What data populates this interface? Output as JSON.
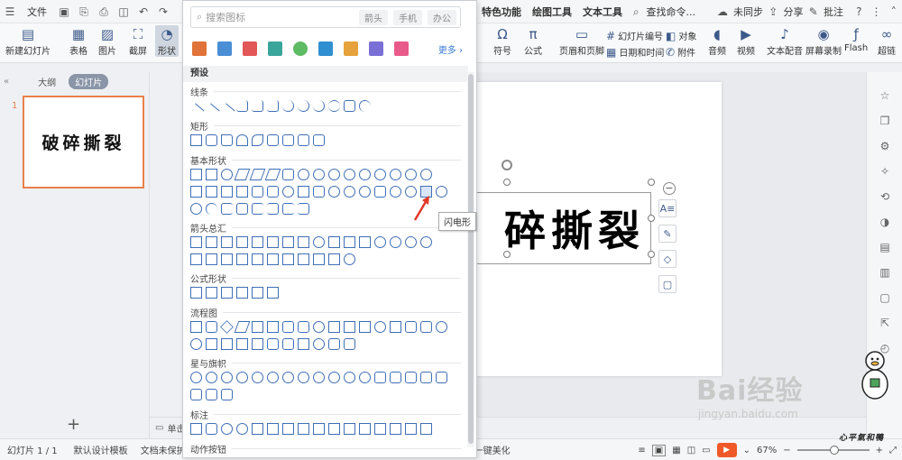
{
  "menubar": {
    "file_label": "文件",
    "tabs": [
      "特色功能",
      "绘图工具",
      "文本工具"
    ],
    "search_placeholder": "查找命令...",
    "sync_label": "未同步",
    "share_label": "分享",
    "comment_label": "批注"
  },
  "ribbon": {
    "new_slide": "新建幻灯片",
    "table": "表格",
    "picture": "图片",
    "screenshot": "截屏",
    "shape": "形状",
    "symbol": "符号",
    "formula": "公式",
    "header_footer": "页眉和页脚",
    "slide_number": "幻灯片编号",
    "object": "对象",
    "datetime": "日期和时间",
    "attachment": "附件",
    "audio": "音频",
    "video": "视频",
    "text_dub": "文本配音",
    "screen_record": "屏幕录制",
    "flash": "Flash",
    "hyperlink": "超链"
  },
  "left_panel": {
    "tab_outline": "大纲",
    "tab_slides": "幻灯片",
    "slide_number": "1",
    "thumb_text": "破碎撕裂"
  },
  "shape_panel": {
    "search_placeholder": "搜索图标",
    "tags": [
      "箭头",
      "手机",
      "办公"
    ],
    "more_label": "更多 ›",
    "preset_label": "预设",
    "sections": {
      "lines": "线条",
      "rect": "矩形",
      "basic": "基本形状",
      "arrows": "箭头总汇",
      "formula": "公式形状",
      "flowchart": "流程图",
      "stars": "星与旗帜",
      "callouts": "标注",
      "action": "动作按钮"
    },
    "tooltip": "闪电形"
  },
  "canvas": {
    "textbox_text": "碎撕裂"
  },
  "notes": {
    "label": "单击"
  },
  "statusbar": {
    "slide_info": "幻灯片 1 / 1",
    "template": "默认设计模板",
    "protect": "文档未保护",
    "beautify": "一键美化",
    "zoom": "67%"
  },
  "watermark": {
    "brand": "Bai经验",
    "url": "jingyan.baidu.com",
    "duck_caption": "心平氣和鴨"
  },
  "colors": {
    "accent_orange": "#f05a28",
    "shape_blue": "#3f6fb5",
    "selection_orange": "#e8814a"
  }
}
